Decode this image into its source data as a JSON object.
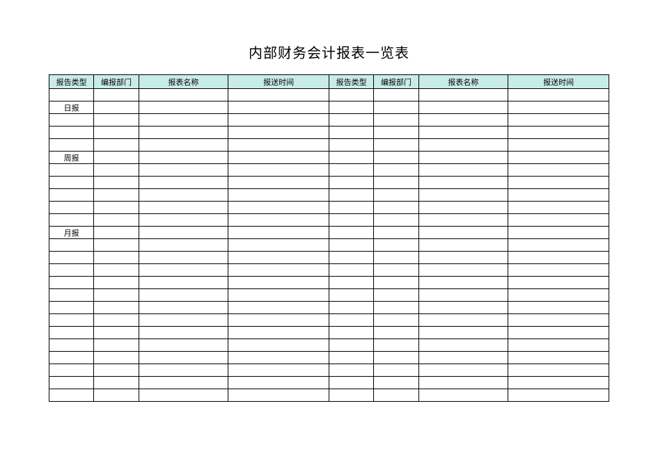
{
  "title": "内部财务会计报表一览表",
  "headers": [
    "报告类型",
    "编报部门",
    "报表名称",
    "报送时间",
    "报告类型",
    "编报部门",
    "报表名称",
    "报送时间"
  ],
  "rows": [
    {
      "col0": ""
    },
    {
      "col0": "日报"
    },
    {
      "col0": ""
    },
    {
      "col0": ""
    },
    {
      "col0": ""
    },
    {
      "col0": "周报"
    },
    {
      "col0": ""
    },
    {
      "col0": ""
    },
    {
      "col0": ""
    },
    {
      "col0": ""
    },
    {
      "col0": ""
    },
    {
      "col0": "月报"
    },
    {
      "col0": ""
    },
    {
      "col0": ""
    },
    {
      "col0": ""
    },
    {
      "col0": ""
    },
    {
      "col0": ""
    },
    {
      "col0": ""
    },
    {
      "col0": ""
    },
    {
      "col0": ""
    },
    {
      "col0": ""
    },
    {
      "col0": ""
    },
    {
      "col0": ""
    },
    {
      "col0": ""
    },
    {
      "col0": ""
    }
  ]
}
